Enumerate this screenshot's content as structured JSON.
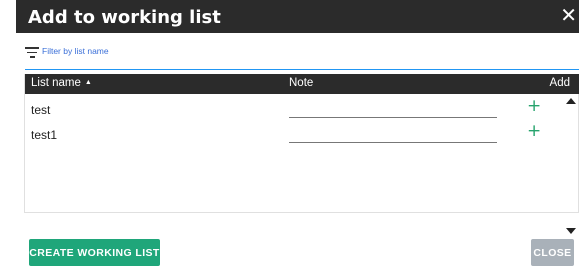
{
  "dialog": {
    "title": "Add to working list",
    "close_icon": "close-icon"
  },
  "filter": {
    "placeholder": "Filter by list name",
    "icon": "filter-lines-icon",
    "accent_color": "#2196f3"
  },
  "table": {
    "columns": {
      "name": "List name",
      "name_sort": "▲",
      "note": "Note",
      "add": "Add"
    },
    "rows": [
      {
        "name": "test",
        "note": "",
        "add_symbol": "+"
      },
      {
        "name": "test1",
        "note": "",
        "add_symbol": "+"
      }
    ]
  },
  "buttons": {
    "create": "CREATE WORKING LIST",
    "close": "CLOSE"
  },
  "colors": {
    "header_bg": "#2b2b2b",
    "create_bg": "#1fa67a",
    "close_bg": "#a9b1b9",
    "add_color": "#26a36d"
  }
}
